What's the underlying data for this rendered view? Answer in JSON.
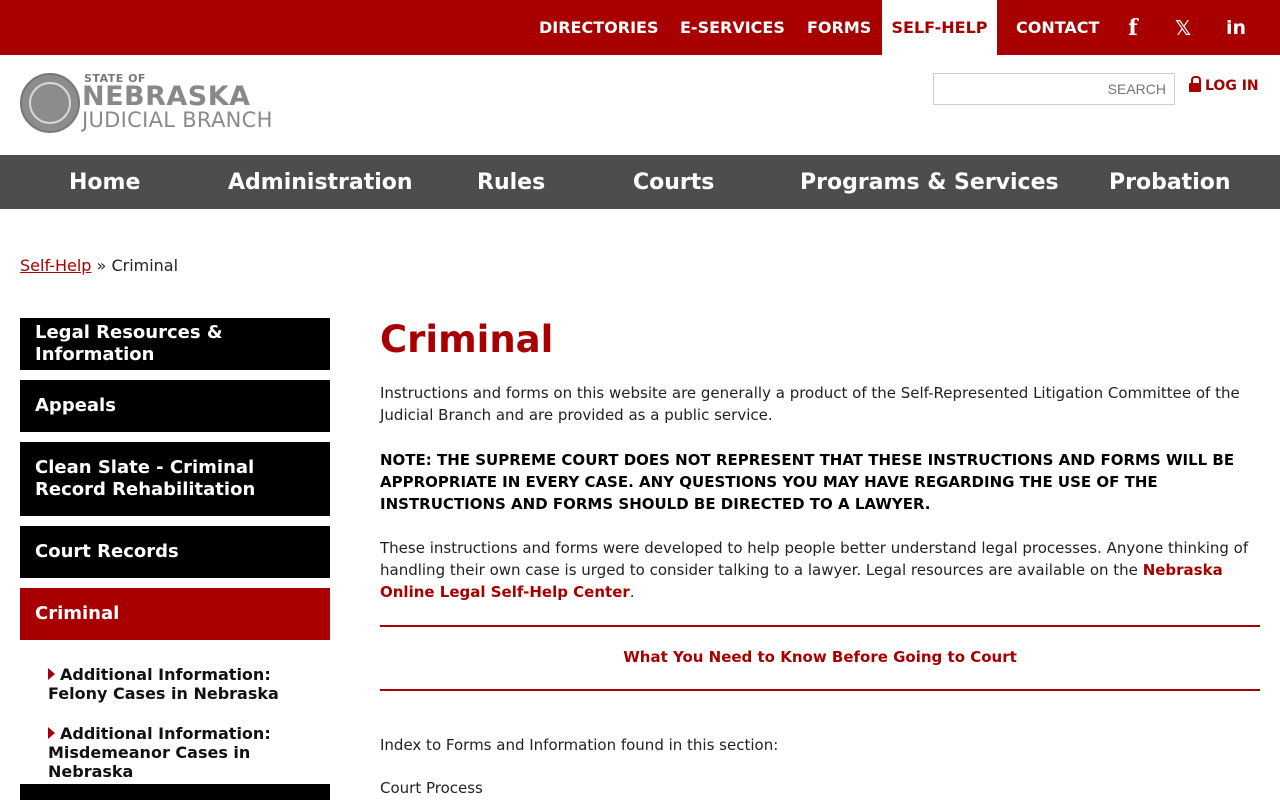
{
  "topnav": {
    "directories": "DIRECTORIES",
    "eservices": "E-SERVICES",
    "forms": "FORMS",
    "selfhelp": "SELF-HELP",
    "contact": "CONTACT",
    "facebook": "f",
    "x": "𝕏",
    "linkedin": "in"
  },
  "logo": {
    "state_of": "STATE OF",
    "nebraska": "NEBRASKA",
    "judicial_branch": "JUDICIAL BRANCH"
  },
  "search": {
    "placeholder": "SEARCH"
  },
  "login": {
    "label": "LOG IN"
  },
  "mainnav": {
    "home": "Home",
    "administration": "Administration",
    "rules": "Rules",
    "courts": "Courts",
    "programs": "Programs & Services",
    "probation": "Probation"
  },
  "breadcrumb": {
    "parent": "Self-Help",
    "separator": "»",
    "current": "Criminal"
  },
  "sidebar": {
    "items": [
      {
        "label": "Legal Resources & Information"
      },
      {
        "label": "Appeals"
      },
      {
        "label": "Clean Slate - Criminal Record Rehabilitation"
      },
      {
        "label": "Court Records"
      },
      {
        "label": "Criminal"
      }
    ],
    "subitems": [
      {
        "label": "Additional Information: Felony Cases in Nebraska"
      },
      {
        "label": "Additional Information: Misdemeanor Cases in Nebraska"
      }
    ]
  },
  "content": {
    "title": "Criminal",
    "intro": "Instructions and forms on this website are generally a product of the Self-Represented Litigation Committee of the Judicial Branch and are provided as a public service.",
    "note": "NOTE: THE SUPREME COURT DOES NOT REPRESENT THAT THESE INSTRUCTIONS AND FORMS WILL BE APPROPRIATE IN EVERY CASE. ANY QUESTIONS YOU MAY HAVE REGARDING THE USE OF THE INSTRUCTIONS AND FORMS SHOULD BE DIRECTED TO A LAWYER.",
    "help_text": "These instructions and forms were developed to help people better understand legal processes. Anyone thinking of handling their own case is urged to consider talking to a lawyer. Legal resources are available on the ",
    "help_link": "Nebraska Online Legal Self-Help Center",
    "help_end": ".",
    "know_link": "What You Need to Know Before Going to Court",
    "index_text": "Index to Forms and Information found in this section:",
    "court_process": "Court Process"
  },
  "colors": {
    "brand_red": "#a80000",
    "nav_gray": "#4d4d4d"
  }
}
